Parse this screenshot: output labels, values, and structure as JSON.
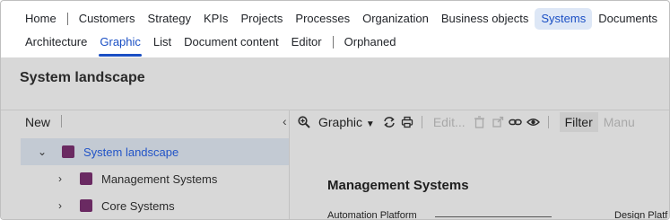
{
  "nav": {
    "row1": [
      "Home",
      "Customers",
      "Strategy",
      "KPIs",
      "Projects",
      "Processes",
      "Organization",
      "Business objects",
      "Systems",
      "Documents"
    ],
    "row2": [
      "Architecture",
      "Graphic",
      "List",
      "Document content",
      "Editor",
      "Orphaned"
    ],
    "highlighted": "Systems",
    "active": "Graphic"
  },
  "page": {
    "title": "System landscape"
  },
  "tree": {
    "new_label": "New",
    "items": [
      {
        "label": "System landscape",
        "selected": true
      },
      {
        "label": "Management Systems",
        "selected": false
      },
      {
        "label": "Core Systems",
        "selected": false
      }
    ]
  },
  "toolbar": {
    "view_label": "Graphic",
    "edit_label": "Edit...",
    "filter_label": "Filter",
    "manual_label": "Manu"
  },
  "graphic": {
    "heading": "Management Systems",
    "items": [
      "Automation Platform",
      "Design Platf"
    ]
  },
  "colors": {
    "accent": "#1a4fc4",
    "highlight_bg": "#dde7f6",
    "tree_square": "#6a2a62",
    "selected_row": "#c3cad3"
  }
}
